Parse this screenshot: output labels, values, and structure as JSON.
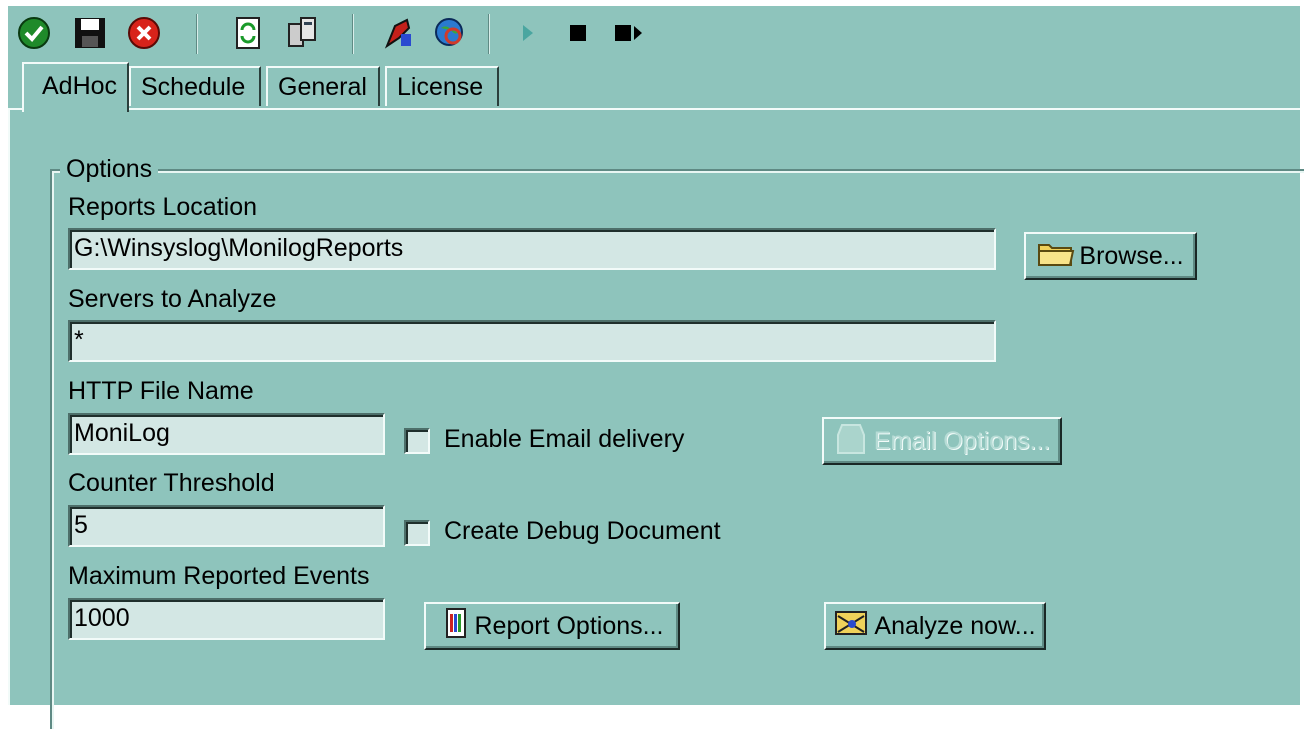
{
  "toolbar": {
    "icons": [
      "ok-check-icon",
      "save-disk-icon",
      "cancel-x-icon",
      "refresh-icon",
      "server-config-icon",
      "paint-icon",
      "globe-search-icon",
      "play-icon",
      "stop-icon",
      "step-icon"
    ]
  },
  "tabs": [
    {
      "label": "AdHoc",
      "active": true
    },
    {
      "label": "Schedule",
      "active": false
    },
    {
      "label": "General",
      "active": false
    },
    {
      "label": "License",
      "active": false
    }
  ],
  "options": {
    "legend": "Options",
    "reports_location_label": "Reports Location",
    "reports_location_value": "G:\\Winsyslog\\MonilogReports",
    "browse_label": "Browse...",
    "servers_label": "Servers to Analyze",
    "servers_value": "*",
    "http_file_label": "HTTP File Name",
    "http_file_value": "MoniLog",
    "enable_email_label": "Enable Email delivery",
    "email_options_label": "Email Options...",
    "counter_threshold_label": "Counter Threshold",
    "counter_threshold_value": "5",
    "debug_doc_label": "Create Debug Document",
    "max_events_label": "Maximum Reported Events",
    "max_events_value": "1000",
    "report_options_label": "Report Options...",
    "analyze_now_label": "Analyze now..."
  },
  "colors": {
    "background": "#8ec4bc",
    "field": "#d3e7e4"
  }
}
